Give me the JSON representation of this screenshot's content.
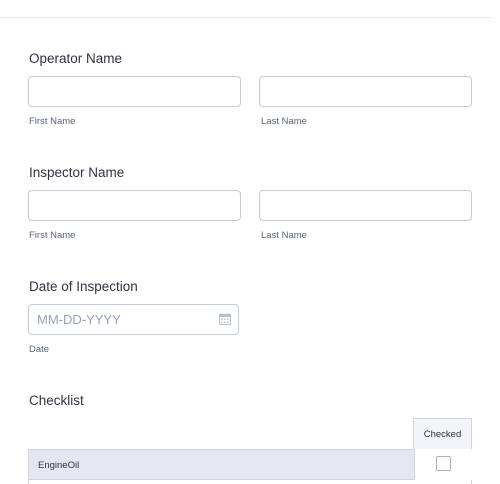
{
  "operator": {
    "label": "Operator Name",
    "first_name": {
      "value": "",
      "sublabel": "First Name"
    },
    "last_name": {
      "value": "",
      "sublabel": "Last Name"
    }
  },
  "inspector": {
    "label": "Inspector Name",
    "first_name": {
      "value": "",
      "sublabel": "First Name"
    },
    "last_name": {
      "value": "",
      "sublabel": "Last Name"
    }
  },
  "date_of_inspection": {
    "label": "Date of Inspection",
    "value": "",
    "placeholder": "MM-DD-YYYY",
    "sublabel": "Date",
    "icon": "calendar-icon"
  },
  "checklist": {
    "label": "Checklist",
    "columns": [
      "Checked"
    ],
    "rows": [
      {
        "label": "EngineOil",
        "checked": false
      }
    ]
  },
  "colors": {
    "text": "#2c3345",
    "sublabel": "#57647e",
    "border": "#c3cad8",
    "row_bg": "#e4e7f1"
  }
}
